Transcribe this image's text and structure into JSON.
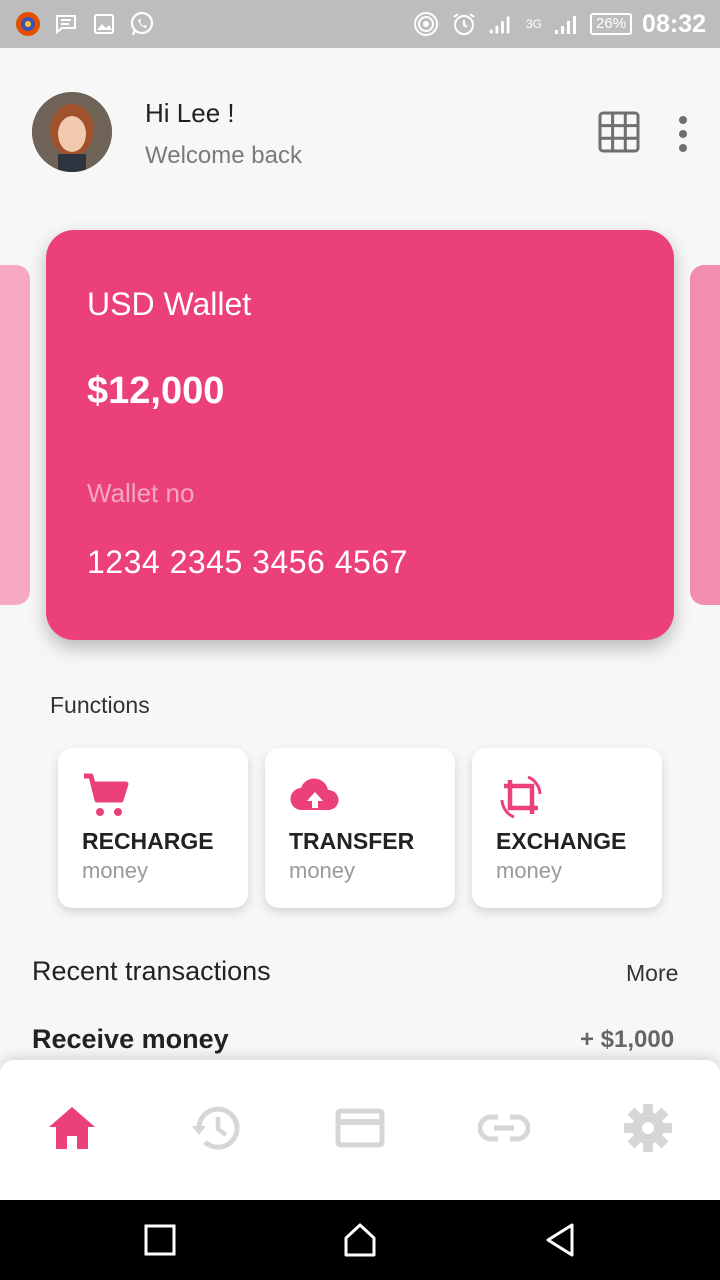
{
  "status_bar": {
    "battery": "26%",
    "time": "08:32",
    "network": "3G"
  },
  "header": {
    "greeting": "Hi Lee !",
    "subtitle": "Welcome back"
  },
  "wallet": {
    "title": "USD Wallet",
    "amount": "$12,000",
    "number_label": "Wallet no",
    "number": "1234 2345 3456 4567",
    "color": "#ec407a"
  },
  "functions": {
    "title": "Functions",
    "items": [
      {
        "title": "RECHARGE",
        "sub": "money",
        "icon": "cart-icon"
      },
      {
        "title": "TRANSFER",
        "sub": "money",
        "icon": "cloud-upload-icon"
      },
      {
        "title": "EXCHANGE",
        "sub": "money",
        "icon": "exchange-icon"
      }
    ]
  },
  "transactions": {
    "title": "Recent transactions",
    "more": "More",
    "items": [
      {
        "label": "Receive money",
        "amount": "+ $1,000"
      }
    ]
  },
  "bottom_nav": {
    "items": [
      "home-icon",
      "history-icon",
      "card-icon",
      "link-icon",
      "settings-icon"
    ],
    "active_color": "#ec407a",
    "inactive_color": "#d6d6d6"
  }
}
